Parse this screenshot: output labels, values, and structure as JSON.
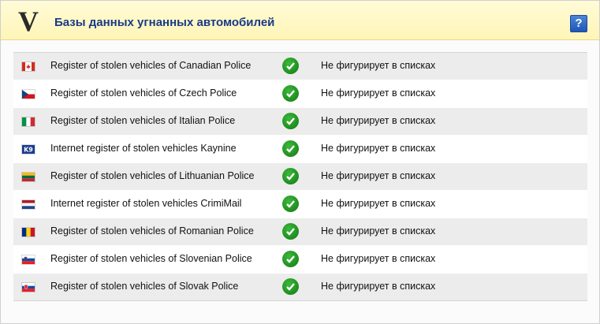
{
  "header": {
    "logo_letter": "V",
    "title": "Базы данных угнанных автомобилей",
    "help_label": "?"
  },
  "registers": [
    {
      "flag": "canada-flag-icon",
      "name": "Register of stolen vehicles of Canadian Police",
      "status": "Не фигурирует в списках"
    },
    {
      "flag": "czech-flag-icon",
      "name": "Register of stolen vehicles of Czech Police",
      "status": "Не фигурирует в списках"
    },
    {
      "flag": "italy-flag-icon",
      "name": "Register of stolen vehicles of Italian Police",
      "status": "Не фигурирует в списках"
    },
    {
      "flag": "k9-logo-icon",
      "name": "Internet register of stolen vehicles Kaynine",
      "status": "Не фигурирует в списках",
      "flag_text": "K9"
    },
    {
      "flag": "lithuania-flag-icon",
      "name": "Register of stolen vehicles of Lithuanian Police",
      "status": "Не фигурирует в списках"
    },
    {
      "flag": "netherlands-flag-icon",
      "name": "Internet register of stolen vehicles CrimiMail",
      "status": "Не фигурирует в списках"
    },
    {
      "flag": "romania-flag-icon",
      "name": "Register of stolen vehicles of Romanian Police",
      "status": "Не фигурирует в списках"
    },
    {
      "flag": "slovenia-flag-icon",
      "name": "Register of stolen vehicles of Slovenian Police",
      "status": "Не фигурирует в списках"
    },
    {
      "flag": "slovakia-flag-icon",
      "name": "Register of stolen vehicles of Slovak Police",
      "status": "Не фигурирует в списках"
    }
  ],
  "colors": {
    "header_bg": "#fff5b8",
    "title": "#1a3a86",
    "check": "#1e9a1e",
    "help": "#2b63c0"
  }
}
